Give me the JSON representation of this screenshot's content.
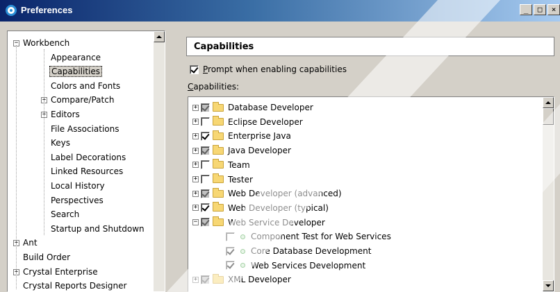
{
  "window": {
    "title": "Preferences",
    "min_label": "_",
    "max_label": "□",
    "close_label": "×"
  },
  "tree": {
    "items": [
      {
        "label": "Workbench",
        "expander": "−"
      },
      {
        "label": "Appearance"
      },
      {
        "label": "Capabilities",
        "selected": true
      },
      {
        "label": "Colors and Fonts"
      },
      {
        "label": "Compare/Patch",
        "expander": "+"
      },
      {
        "label": "Editors",
        "expander": "+"
      },
      {
        "label": "File Associations"
      },
      {
        "label": "Keys"
      },
      {
        "label": "Label Decorations"
      },
      {
        "label": "Linked Resources"
      },
      {
        "label": "Local History"
      },
      {
        "label": "Perspectives"
      },
      {
        "label": "Search"
      },
      {
        "label": "Startup and Shutdown"
      },
      {
        "label": "Ant",
        "expander": "+"
      },
      {
        "label": "Build Order"
      },
      {
        "label": "Crystal Enterprise",
        "expander": "+"
      },
      {
        "label": "Crystal Reports Designer"
      }
    ]
  },
  "main": {
    "header": "Capabilities",
    "prompt_label_prefix": "P",
    "prompt_label_rest": "rompt when enabling capabilities",
    "prompt_checked": true,
    "capabilities_label_prefix": "C",
    "capabilities_label_rest": "apabilities:",
    "capabilities": [
      {
        "label": "Database Developer",
        "state": "gray-checked",
        "expandable": true
      },
      {
        "label": "Eclipse Developer",
        "state": "unchecked",
        "expandable": true
      },
      {
        "label": "Enterprise Java",
        "state": "checked",
        "expandable": true
      },
      {
        "label": "Java Developer",
        "state": "gray-checked",
        "expandable": true
      },
      {
        "label": "Team",
        "state": "unchecked",
        "expandable": true
      },
      {
        "label": "Tester",
        "state": "unchecked",
        "expandable": true
      },
      {
        "label": "Web Developer (advanced)",
        "state": "gray-checked",
        "expandable": true
      },
      {
        "label": "Web Developer (typical)",
        "state": "checked",
        "expandable": true
      },
      {
        "label": "Web Service Developer",
        "state": "gray-checked",
        "expandable": true,
        "expanded": true
      },
      {
        "label": "Component Test for Web Services",
        "state": "unchecked",
        "child": true
      },
      {
        "label": "Core Database Development",
        "state": "checked",
        "child": true
      },
      {
        "label": "Web Services Development",
        "state": "checked",
        "child": true
      },
      {
        "label": "XML Developer",
        "state": "gray-checked",
        "expandable": true
      }
    ]
  },
  "colors": {
    "titlebar_start": "#0a246a",
    "titlebar_end": "#a6caf0",
    "dialog_bg": "#d4d0c8",
    "folder": "#f7d774"
  }
}
